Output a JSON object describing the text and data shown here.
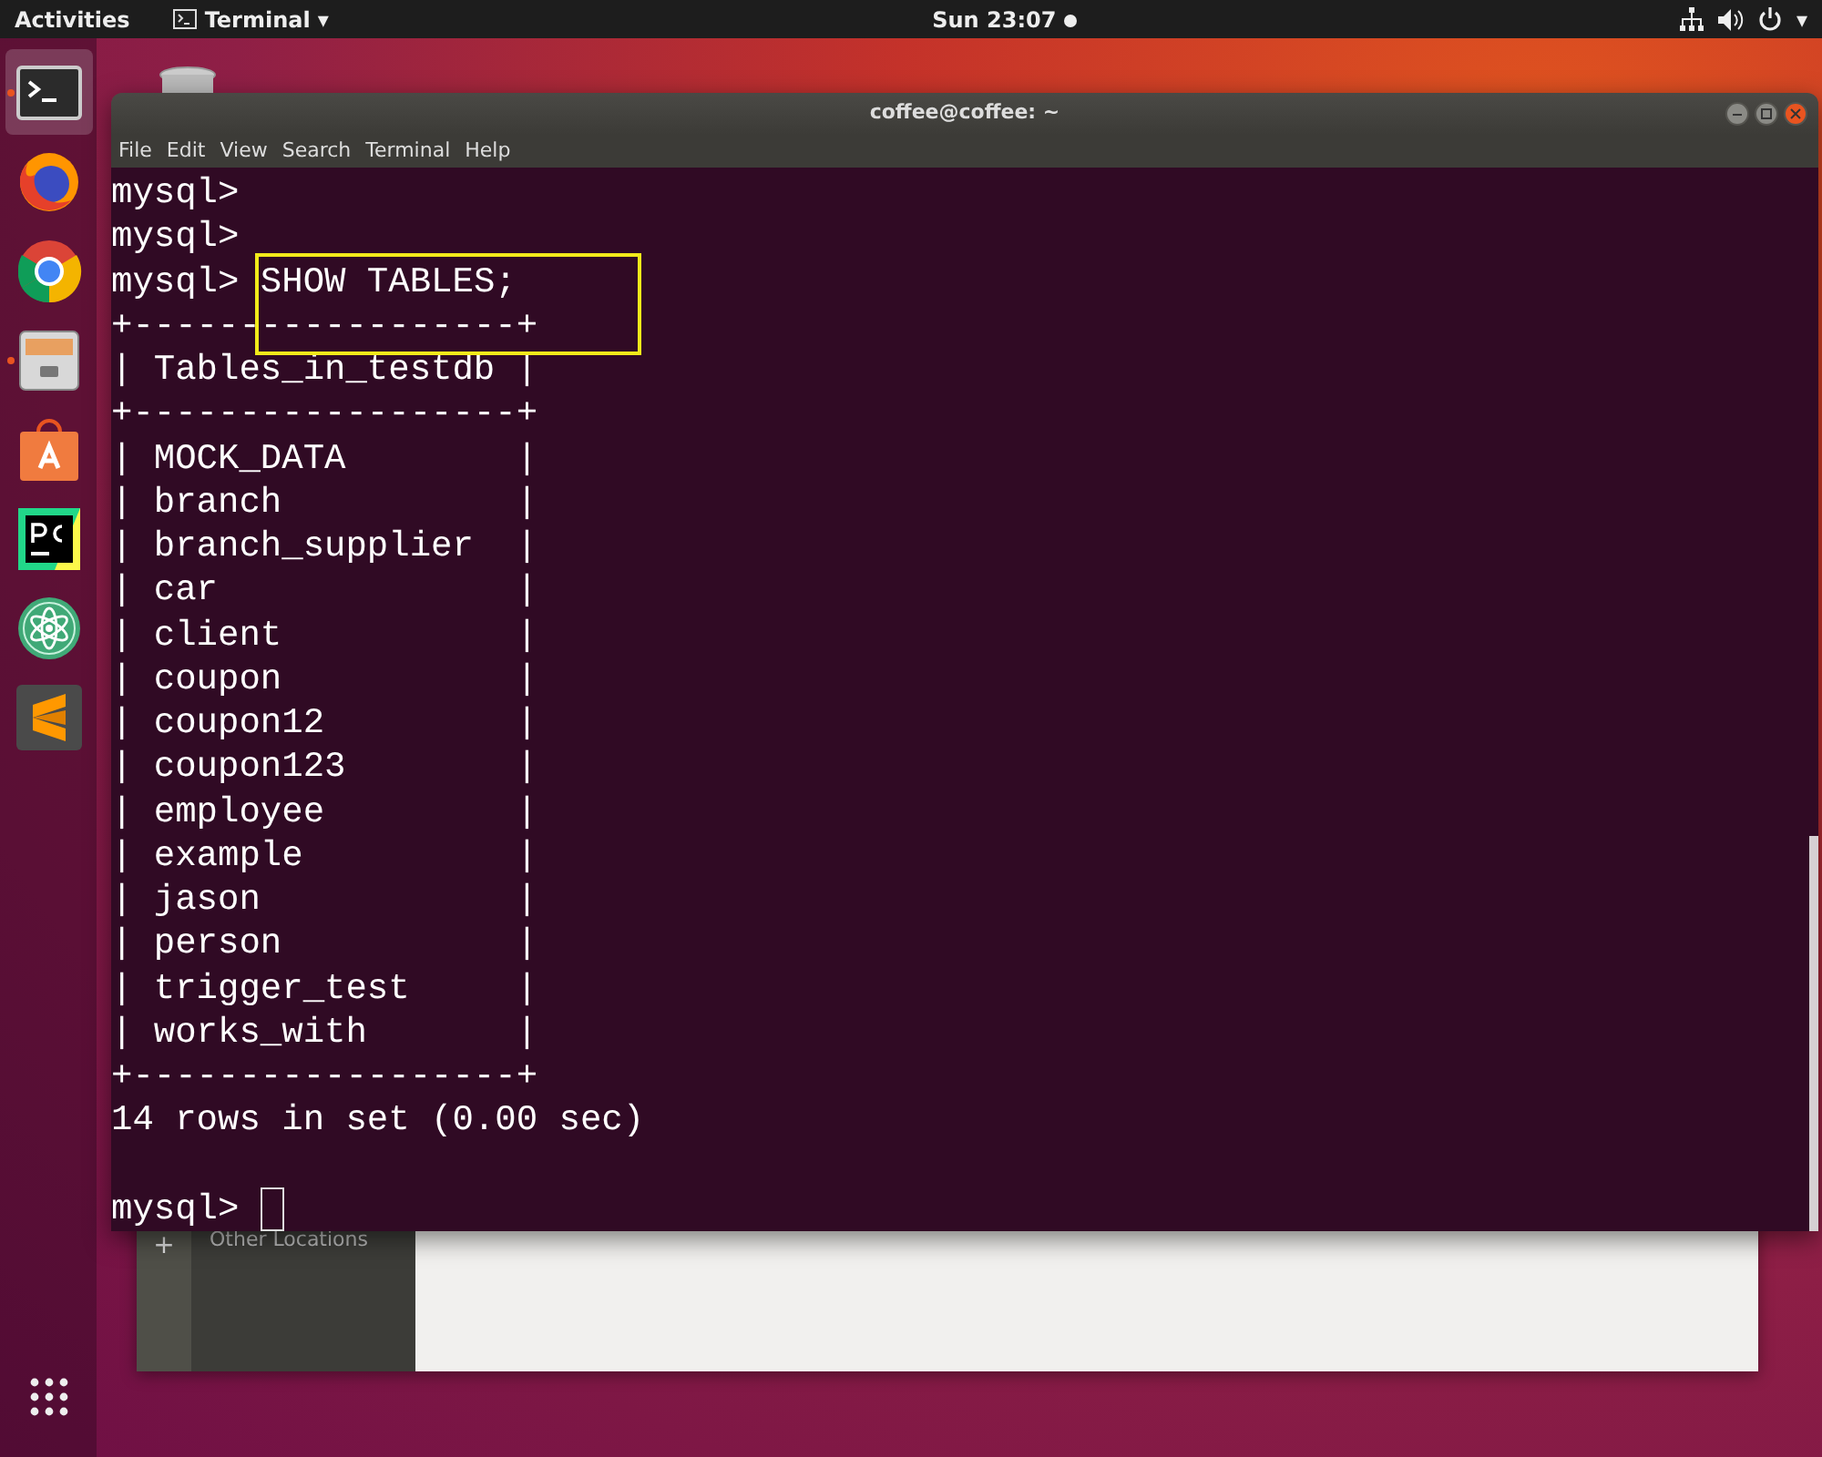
{
  "top_bar": {
    "activities": "Activities",
    "app_menu": "Terminal",
    "app_menu_caret": "▾",
    "clock": "Sun 23:07",
    "notification_dot": true,
    "system_caret": "▾"
  },
  "dock": {
    "items": [
      {
        "kind": "terminal",
        "running": true,
        "selected": true
      },
      {
        "kind": "firefox",
        "running": false,
        "selected": false
      },
      {
        "kind": "chrome",
        "running": false,
        "selected": false
      },
      {
        "kind": "files",
        "running": true,
        "selected": false
      },
      {
        "kind": "software",
        "running": false,
        "selected": false
      },
      {
        "kind": "pycharm",
        "running": false,
        "selected": false
      },
      {
        "kind": "atom",
        "running": false,
        "selected": false
      },
      {
        "kind": "sublime",
        "running": false,
        "selected": false
      }
    ]
  },
  "background_window": {
    "add_symbol": "+",
    "sidebar_items": [
      {
        "label": "Other Locations"
      }
    ]
  },
  "terminal": {
    "title": "coffee@coffee: ~",
    "menu": [
      "File",
      "Edit",
      "View",
      "Search",
      "Terminal",
      "Help"
    ],
    "lines": [
      {
        "kind": "prompt",
        "prompt": "mysql>",
        "cursor": false
      },
      {
        "kind": "prompt",
        "prompt": "mysql>",
        "cursor": false
      },
      {
        "kind": "prompt",
        "prompt": "mysql>",
        "command": "SHOW TABLES;",
        "highlighted": true,
        "cursor": false
      },
      {
        "kind": "output",
        "text": "+------------------+"
      },
      {
        "kind": "output",
        "text": "| Tables_in_testdb |"
      },
      {
        "kind": "output",
        "text": "+------------------+"
      },
      {
        "kind": "output",
        "text": "| MOCK_DATA        |"
      },
      {
        "kind": "output",
        "text": "| branch           |"
      },
      {
        "kind": "output",
        "text": "| branch_supplier  |"
      },
      {
        "kind": "output",
        "text": "| car              |"
      },
      {
        "kind": "output",
        "text": "| client           |"
      },
      {
        "kind": "output",
        "text": "| coupon           |"
      },
      {
        "kind": "output",
        "text": "| coupon12         |"
      },
      {
        "kind": "output",
        "text": "| coupon123        |"
      },
      {
        "kind": "output",
        "text": "| employee         |"
      },
      {
        "kind": "output",
        "text": "| example          |"
      },
      {
        "kind": "output",
        "text": "| jason            |"
      },
      {
        "kind": "output",
        "text": "| person           |"
      },
      {
        "kind": "output",
        "text": "| trigger_test     |"
      },
      {
        "kind": "output",
        "text": "| works_with       |"
      },
      {
        "kind": "output",
        "text": "+------------------+"
      },
      {
        "kind": "output",
        "text": "14 rows in set (0.00 sec)"
      },
      {
        "kind": "blank"
      },
      {
        "kind": "prompt",
        "prompt": "mysql>",
        "cursor": true
      }
    ]
  }
}
